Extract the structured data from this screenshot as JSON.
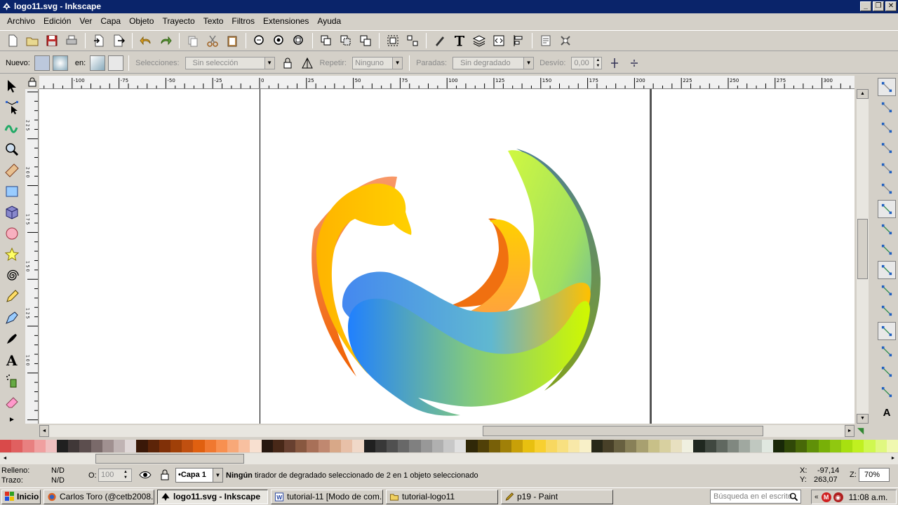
{
  "window": {
    "title": "logo11.svg - Inkscape"
  },
  "menu": [
    "Archivo",
    "Edición",
    "Ver",
    "Capa",
    "Objeto",
    "Trayecto",
    "Texto",
    "Filtros",
    "Extensiones",
    "Ayuda"
  ],
  "controls": {
    "nuevo_label": "Nuevo:",
    "en_label": "en:",
    "selecciones_label": "Selecciones:",
    "selecciones_value": "Sin selección",
    "repetir_label": "Repetir:",
    "repetir_value": "Ninguno",
    "paradas_label": "Paradas:",
    "paradas_value": "Sin degradado",
    "desvio_label": "Desvío:",
    "desvio_value": "0,00"
  },
  "ruler": {
    "top_labels": [
      "-100",
      "-75",
      "-50",
      "-25",
      "0",
      "25",
      "50",
      "75",
      "100",
      "125",
      "150",
      "175",
      "200",
      "225",
      "250",
      "275",
      "300"
    ],
    "left_labels": [
      "2 2 5",
      "2 0 0",
      "1 7 5",
      "1 5 0",
      "1 2 5",
      "1 0 0"
    ]
  },
  "status": {
    "relleno_label": "Relleno:",
    "relleno_value": "N/D",
    "trazo_label": "Trazo:",
    "trazo_value": "N/D",
    "opacity_label": "O:",
    "opacity_value": "100",
    "layer_value": "•Capa 1",
    "message_bold": "Ningún",
    "message": " tirador de degradado seleccionado de 2 en 1 objeto seleccionado",
    "x_label": "X:",
    "x_value": "-97,14",
    "y_label": "Y:",
    "y_value": "263,07",
    "zoom_label": "Z:",
    "zoom_value": "70%"
  },
  "taskbar": {
    "start": "Inicio",
    "tasks": [
      "Carlos Toro (@cetb2008...",
      "logo11.svg - Inkscape",
      "tutorial-11 [Modo de com...",
      "tutorial-logo11",
      "p19 - Paint"
    ],
    "search_placeholder": "Búsqueda en el escrito",
    "clock": "11:08 a.m."
  },
  "colors": {
    "title_bg": "#0a246a",
    "palette": [
      "#d94a4a",
      "#e06060",
      "#e88080",
      "#f0a0a0",
      "#f0c0c0",
      "#202020",
      "#403838",
      "#5c4e4e",
      "#7a6a6a",
      "#a09090",
      "#c0b4b4",
      "#e0d8d8",
      "#3a1808",
      "#5c2408",
      "#803008",
      "#a04008",
      "#c05010",
      "#e06010",
      "#f07830",
      "#f89050",
      "#f8a878",
      "#f8c0a0",
      "#f8e0d0",
      "#281810",
      "#482818",
      "#684030",
      "#885840",
      "#a87058",
      "#c08870",
      "#d8a888",
      "#e8c0a8",
      "#f0d8c8",
      "#202020",
      "#383838",
      "#505050",
      "#686868",
      "#808080",
      "#989898",
      "#b0b0b0",
      "#c8c8c8",
      "#e0e0e0",
      "#302808",
      "#504008",
      "#786008",
      "#a08008",
      "#c8a008",
      "#e8c010",
      "#f8d030",
      "#f8d860",
      "#f8e080",
      "#f8e8a8",
      "#f8f0c8",
      "#282818",
      "#484028",
      "#686040",
      "#888058",
      "#a8a070",
      "#c8c088",
      "#d8d0a0",
      "#e8e0c0",
      "#f0f0e0",
      "#202820",
      "#404840",
      "#606860",
      "#808880",
      "#a0a8a0",
      "#c0c8c0",
      "#e0e8e0",
      "#182808",
      "#304808",
      "#486808",
      "#609008",
      "#78b008",
      "#90c810",
      "#a8e010",
      "#c0f020",
      "#d0f850",
      "#e0f880",
      "#f0f8b0"
    ]
  }
}
